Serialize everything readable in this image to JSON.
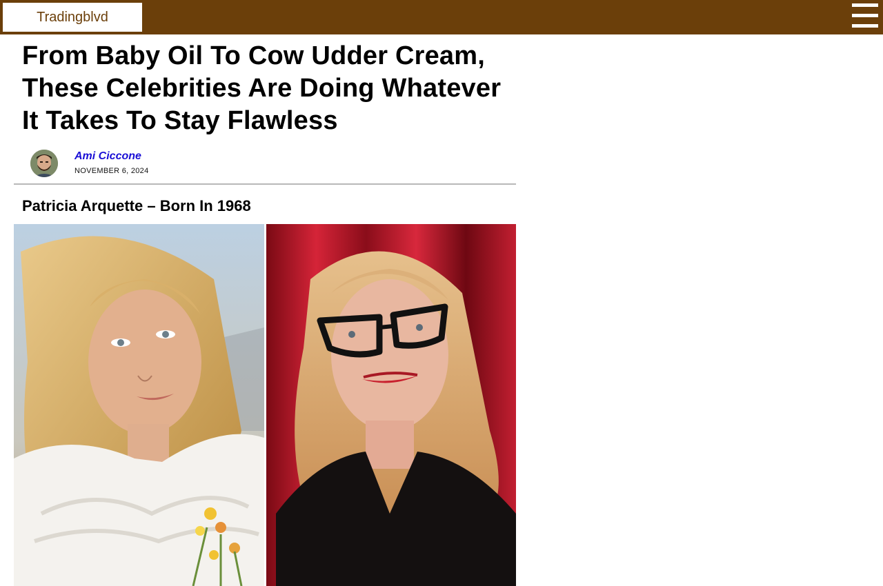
{
  "site": {
    "logo_text": "Tradingblvd",
    "menu_icon": "hamburger-menu-icon",
    "brand_color": "#6b3f0a"
  },
  "article": {
    "headline": "From Baby Oil To Cow Udder Cream, These Celebrities Are Doing Whatever It Takes To Stay Flawless",
    "author": "Ami Ciccone",
    "author_color": "#1a0fd6",
    "date": "NOVEMBER 6, 2024",
    "section_title": "Patricia Arquette – Born In 1968"
  }
}
